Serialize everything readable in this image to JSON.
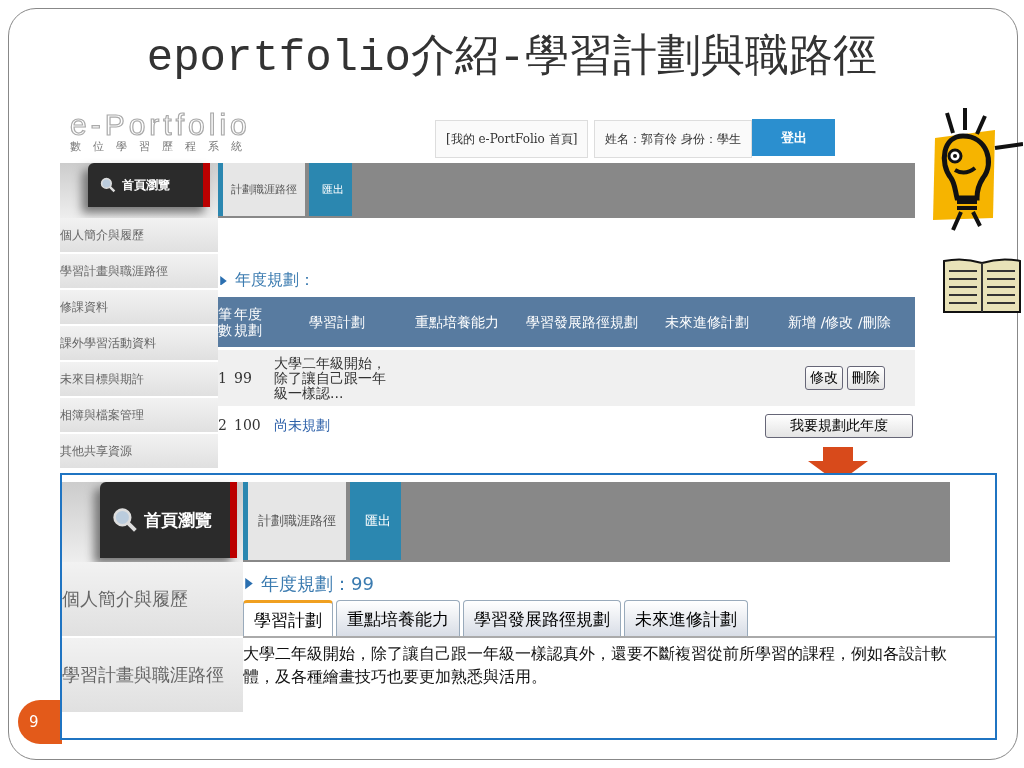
{
  "slide": {
    "title": "eportfolio介紹-學習計劃與職路徑",
    "number": "9"
  },
  "top_screen": {
    "logo": {
      "title": "e-Portfolio",
      "subtitle": "數位學習歷程系統"
    },
    "header_links": [
      {
        "label": "[我的 e-PortFolio 首頁]"
      },
      {
        "label": "姓名：郭育伶  身份：學生"
      }
    ],
    "logout_button": "登出",
    "home_button": "首頁瀏覽",
    "nav_tabs": [
      {
        "label": "計劃職涯路徑",
        "selected": true
      },
      {
        "label": "匯出",
        "selected": false
      }
    ],
    "sidebar": {
      "items": [
        "個人簡介與履歷",
        "學習計畫與職涯路徑",
        "修課資料",
        "課外學習活動資料",
        "未來目標與期許",
        "相簿與檔案管理",
        "其他共享資源"
      ]
    },
    "section_heading": "年度規劃：",
    "table": {
      "columns": [
        "筆數",
        "年度規劃",
        "學習計劃",
        "重點培養能力",
        "學習發展路徑規劃",
        "未來進修計劃",
        "新增 /修改 /刪除"
      ],
      "rows": [
        {
          "kind": "planned",
          "cells": [
            "1",
            "99",
            "大學二年級開始，除了讓自己跟一年級一樣認..."
          ],
          "actions": [
            "修改",
            "刪除"
          ]
        },
        {
          "kind": "unplanned",
          "cells": [
            "2",
            "100",
            "尚未規劃"
          ],
          "actions": [
            "我要規劃此年度"
          ]
        }
      ]
    }
  },
  "bottom_screen": {
    "home_button": "首頁瀏覽",
    "nav_tabs": [
      {
        "label": "計劃職涯路徑",
        "selected": true
      },
      {
        "label": "匯出",
        "selected": false
      }
    ],
    "sidebar": {
      "items": [
        "個人簡介與履歷",
        "學習計畫與職涯路徑"
      ]
    },
    "section_heading": "年度規劃：99",
    "tabs": [
      {
        "label": "學習計劃",
        "selected": true
      },
      {
        "label": "重點培養能力",
        "selected": false
      },
      {
        "label": "學習發展路徑規劃",
        "selected": false
      },
      {
        "label": "未來進修計劃",
        "selected": false
      }
    ],
    "content": "大學二年級開始，除了讓自己跟一年級一樣認真外，還要不斷複習從前所學習的課程，例如各設計軟體，及各種繪畫技巧也要更加熟悉與活用。"
  }
}
